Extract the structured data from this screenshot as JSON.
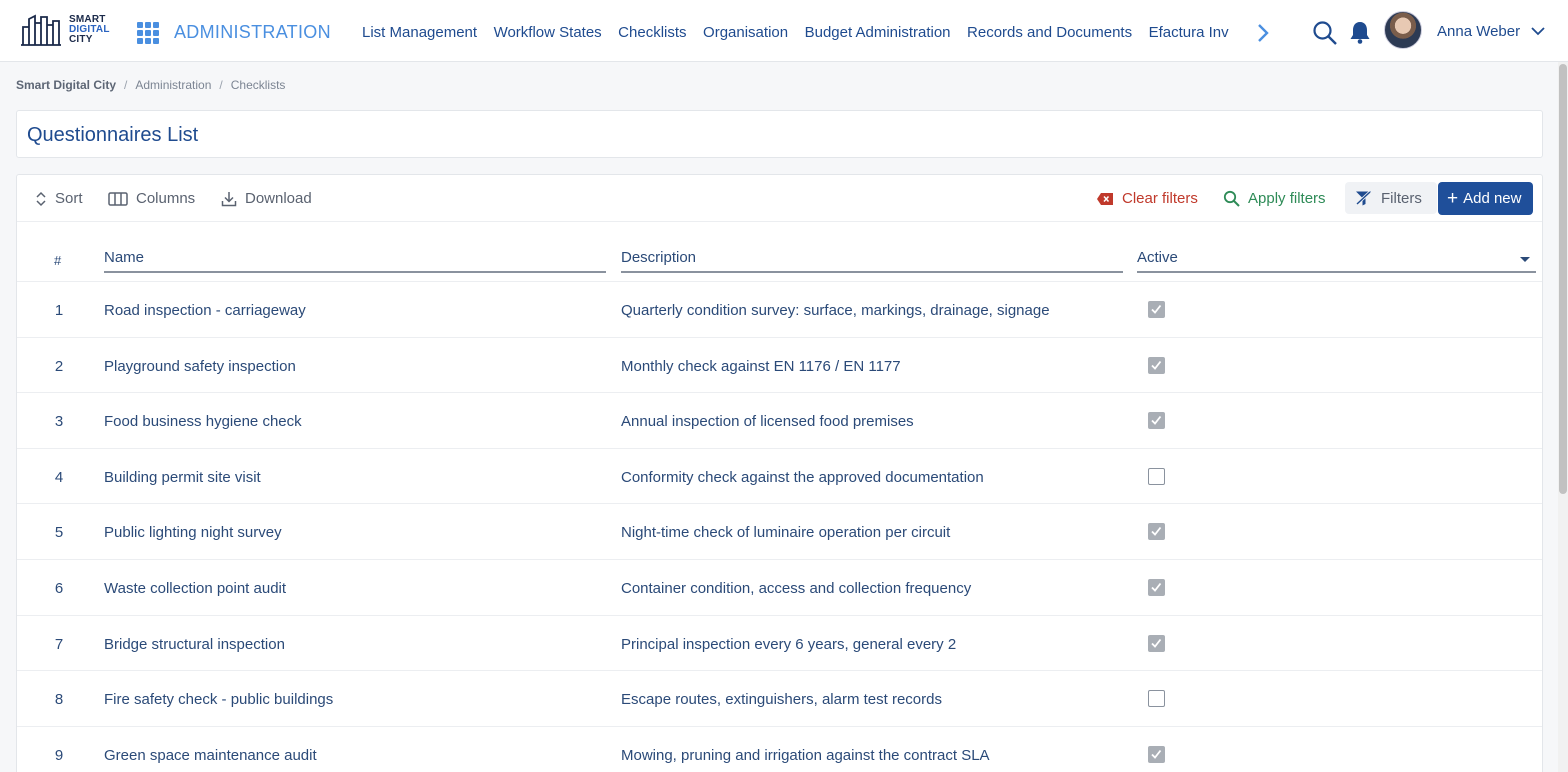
{
  "brand": {
    "logo_lines": [
      "SMART",
      "DIGITAL",
      "CITY"
    ]
  },
  "header": {
    "module": "ADMINISTRATION",
    "nav": [
      {
        "label": "List Management"
      },
      {
        "label": "Workflow States"
      },
      {
        "label": "Checklists"
      },
      {
        "label": "Organisation"
      },
      {
        "label": "Budget Administration"
      },
      {
        "label": "Records and Documents"
      },
      {
        "label": "Efactura Inv"
      }
    ],
    "user": {
      "name": "Anna Weber"
    }
  },
  "breadcrumb": [
    "Smart Digital City",
    "Administration",
    "Checklists"
  ],
  "page": {
    "title": "Questionnaires List"
  },
  "toolbar": {
    "sort": "Sort",
    "columns": "Columns",
    "download": "Download",
    "clear_filters": "Clear filters",
    "apply_filters": "Apply filters",
    "filters": "Filters",
    "add_new": "Add new"
  },
  "table": {
    "columns": {
      "num": "#",
      "name": "Name",
      "description": "Description",
      "active": "Active"
    },
    "rows": [
      {
        "num": "1",
        "name": "Road inspection - carriageway",
        "description": "Quarterly condition survey: surface, markings, drainage, signage",
        "active": true
      },
      {
        "num": "2",
        "name": "Playground safety inspection",
        "description": "Monthly check against EN 1176 / EN 1177",
        "active": true
      },
      {
        "num": "3",
        "name": "Food business hygiene check",
        "description": "Annual inspection of licensed food premises",
        "active": true
      },
      {
        "num": "4",
        "name": "Building permit site visit",
        "description": "Conformity check against the approved documentation",
        "active": false
      },
      {
        "num": "5",
        "name": "Public lighting night survey",
        "description": "Night-time check of luminaire operation per circuit",
        "active": true
      },
      {
        "num": "6",
        "name": "Waste collection point audit",
        "description": "Container condition, access and collection frequency",
        "active": true
      },
      {
        "num": "7",
        "name": "Bridge structural inspection",
        "description": "Principal inspection every 6 years, general every 2",
        "active": true
      },
      {
        "num": "8",
        "name": "Fire safety check - public buildings",
        "description": "Escape routes, extinguishers, alarm test records",
        "active": false
      },
      {
        "num": "9",
        "name": "Green space maintenance audit",
        "description": "Mowing, pruning and irrigation against the contract SLA",
        "active": true
      }
    ]
  },
  "colors": {
    "primary": "#1f4f9a",
    "accent": "#4a8fe0",
    "danger": "#c0392b",
    "success": "#2e8b57"
  },
  "icons": [
    "apps-grid-icon",
    "chevron-right-icon",
    "search-icon",
    "bell-icon",
    "chevron-down-icon",
    "sort-icon",
    "columns-icon",
    "download-icon",
    "clear-filter-icon",
    "magnifier-icon",
    "filter-icon",
    "check-icon"
  ]
}
